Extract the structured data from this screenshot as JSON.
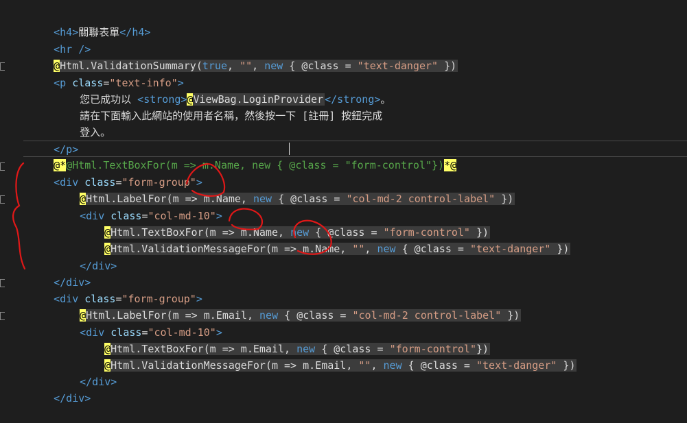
{
  "lines": [
    {
      "s1": "<h4>",
      "s2": "關聯表單",
      "s3": "</h4>"
    },
    {
      "s1": "<hr />"
    },
    {
      "at": "@",
      "s1": "Html.ValidationSummary(",
      "kw1": "true",
      "s2": ", ",
      "str1": "\"\"",
      "s3": ", ",
      "kw2": "new",
      "s4": " { @class = ",
      "str2": "\"text-danger\"",
      "s5": " })"
    },
    {
      "tag1": "<p ",
      "attr1": "class",
      "s1": "=",
      "str1": "\"text-info\"",
      "tag2": ">"
    },
    {
      "s1": "您已成功以 ",
      "tag1": "<strong>",
      "at": "@",
      "s2": "ViewBag.LoginProvider",
      "tag2": "</strong>",
      "s3": "。"
    },
    {
      "s1": "請在下面輸入此網站的使用者名稱，然後按一下 [註冊] 按鈕完成"
    },
    {
      "s1": "登入。"
    },
    {
      "s1": "</p>"
    },
    {
      "at1": "@*",
      "cm": "@Html.TextBoxFor(m => m.Name, new { @class = \"form-control\"})",
      "at2": "*@"
    },
    {
      "tag1": "<div ",
      "attr1": "class",
      "s1": "=",
      "str1": "\"form-group\"",
      "tag2": ">"
    },
    {
      "at": "@",
      "s1": "Html.LabelFor(m => m.Name, ",
      "kw1": "new",
      "s2": " { @class = ",
      "str1": "\"col-md-2 control-label\"",
      "s3": " })"
    },
    {
      "tag1": "<div ",
      "attr1": "class",
      "s1": "=",
      "str1": "\"col-md-10\"",
      "tag2": ">"
    },
    {
      "at": "@",
      "s1": "Html.TextBoxFor(m => m.Name, ",
      "kw1": "new",
      "s2": " { @class = ",
      "str1": "\"form-control\"",
      "s3": " })"
    },
    {
      "at": "@",
      "s1": "Html.ValidationMessageFor(m => m.Name, ",
      "str0": "\"\"",
      "s1b": ", ",
      "kw1": "new",
      "s2": " { @class = ",
      "str1": "\"text-danger\"",
      "s3": " })"
    },
    {
      "s1": "</div>"
    },
    {
      "s1": "</div>"
    },
    {
      "tag1": "<div ",
      "attr1": "class",
      "s1": "=",
      "str1": "\"form-group\"",
      "tag2": ">"
    },
    {
      "at": "@",
      "s1": "Html.LabelFor(m => m.Email, ",
      "kw1": "new",
      "s2": " { @class = ",
      "str1": "\"col-md-2 control-label\"",
      "s3": " })"
    },
    {
      "tag1": "<div ",
      "attr1": "class",
      "s1": "=",
      "str1": "\"col-md-10\"",
      "tag2": ">"
    },
    {
      "at": "@",
      "s1": "Html.TextBoxFor(m => m.Email, ",
      "kw1": "new",
      "s2": " { @class = ",
      "str1": "\"form-control\"",
      "s3": "})"
    },
    {
      "at": "@",
      "s1": "Html.ValidationMessageFor(m => m.Email, ",
      "str0": "\"\"",
      "s1b": ", ",
      "kw1": "new",
      "s2": " { @class = ",
      "str1": "\"text-danger\"",
      "s3": " })"
    },
    {
      "s1": "</div>"
    },
    {
      "s1": "</div>"
    }
  ]
}
